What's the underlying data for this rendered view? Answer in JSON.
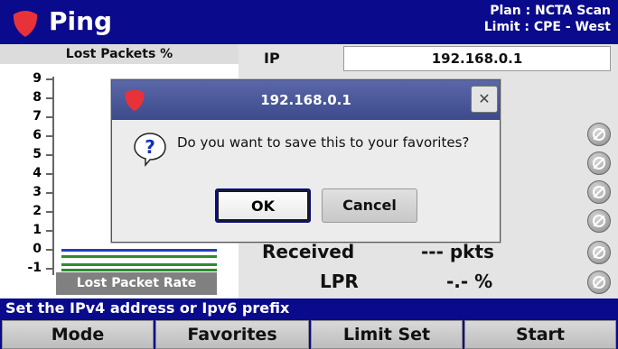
{
  "header": {
    "title": "Ping",
    "plan": "Plan : NCTA Scan",
    "limit": "Limit : CPE - West"
  },
  "chart": {
    "heading": "Lost Packets %",
    "footer": "Lost Packet Rate"
  },
  "chart_data": {
    "type": "line",
    "title": "Lost Packets %",
    "xlabel": "Lost Packet Rate",
    "ylabel": "",
    "ylim": [
      -1,
      9
    ],
    "yticks": [
      "9",
      "8",
      "7",
      "6",
      "5",
      "4",
      "3",
      "2",
      "1",
      "0",
      "-1"
    ],
    "series": [
      {
        "values": [
          0,
          0
        ],
        "color": "#1f3fbf"
      },
      {
        "values": [
          0,
          0
        ],
        "color": "#2e8b2e"
      }
    ]
  },
  "ip": {
    "label": "IP",
    "value": "192.168.0.1"
  },
  "stats": [
    {
      "label": "Received",
      "value": "--- pkts"
    },
    {
      "label": "LPR",
      "value": "-.- %"
    }
  ],
  "status_icons": [
    "pending-icon",
    "pending-icon",
    "pending-icon",
    "pending-icon",
    "pending-icon",
    "pending-icon"
  ],
  "dialog": {
    "title": "192.168.0.1",
    "message": "Do you want to save this to your favorites?",
    "close": "✕",
    "ok": "OK",
    "cancel": "Cancel"
  },
  "hint": "Set the IPv4 address or Ipv6 prefix",
  "softkeys": [
    "Mode",
    "Favorites",
    "Limit Set",
    "Start"
  ],
  "colors": {
    "brand_bar": "#0a0a8c",
    "logo": "#e8323a"
  }
}
